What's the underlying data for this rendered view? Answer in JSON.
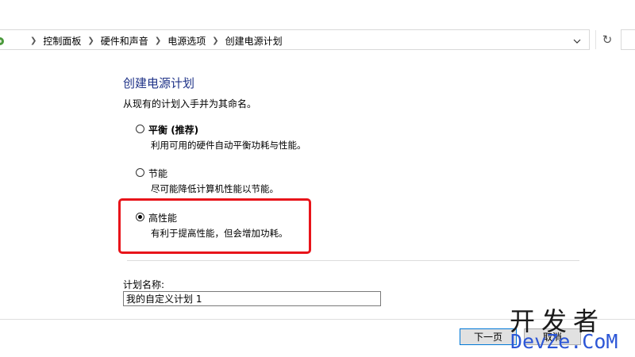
{
  "breadcrumb": {
    "items": [
      "控制面板",
      "硬件和声音",
      "电源选项",
      "创建电源计划"
    ],
    "separator_icon": "chevron-right-icon"
  },
  "page": {
    "title": "创建电源计划",
    "subtitle": "从现有的计划入手并为其命名。"
  },
  "plans": [
    {
      "label_main": "平衡",
      "label_extra": " (推荐)",
      "description": "利用可用的硬件自动平衡功耗与性能。",
      "selected": false
    },
    {
      "label_main": "节能",
      "label_extra": "",
      "description": "尽可能降低计算机性能以节能。",
      "selected": false
    },
    {
      "label_main": "高性能",
      "label_extra": "",
      "description": "有利于提高性能，但会增加功耗。",
      "selected": true
    }
  ],
  "plan_name": {
    "label": "计划名称:",
    "value": "我的自定义计划 1"
  },
  "buttons": {
    "next": "下一页",
    "cancel": "取消"
  },
  "watermark": {
    "top": "开发者",
    "bottom": "DevZe.CoM"
  },
  "colors": {
    "heading": "#1e3287",
    "highlight": "#e8141a",
    "watermark_blue": "#2c56d6"
  }
}
